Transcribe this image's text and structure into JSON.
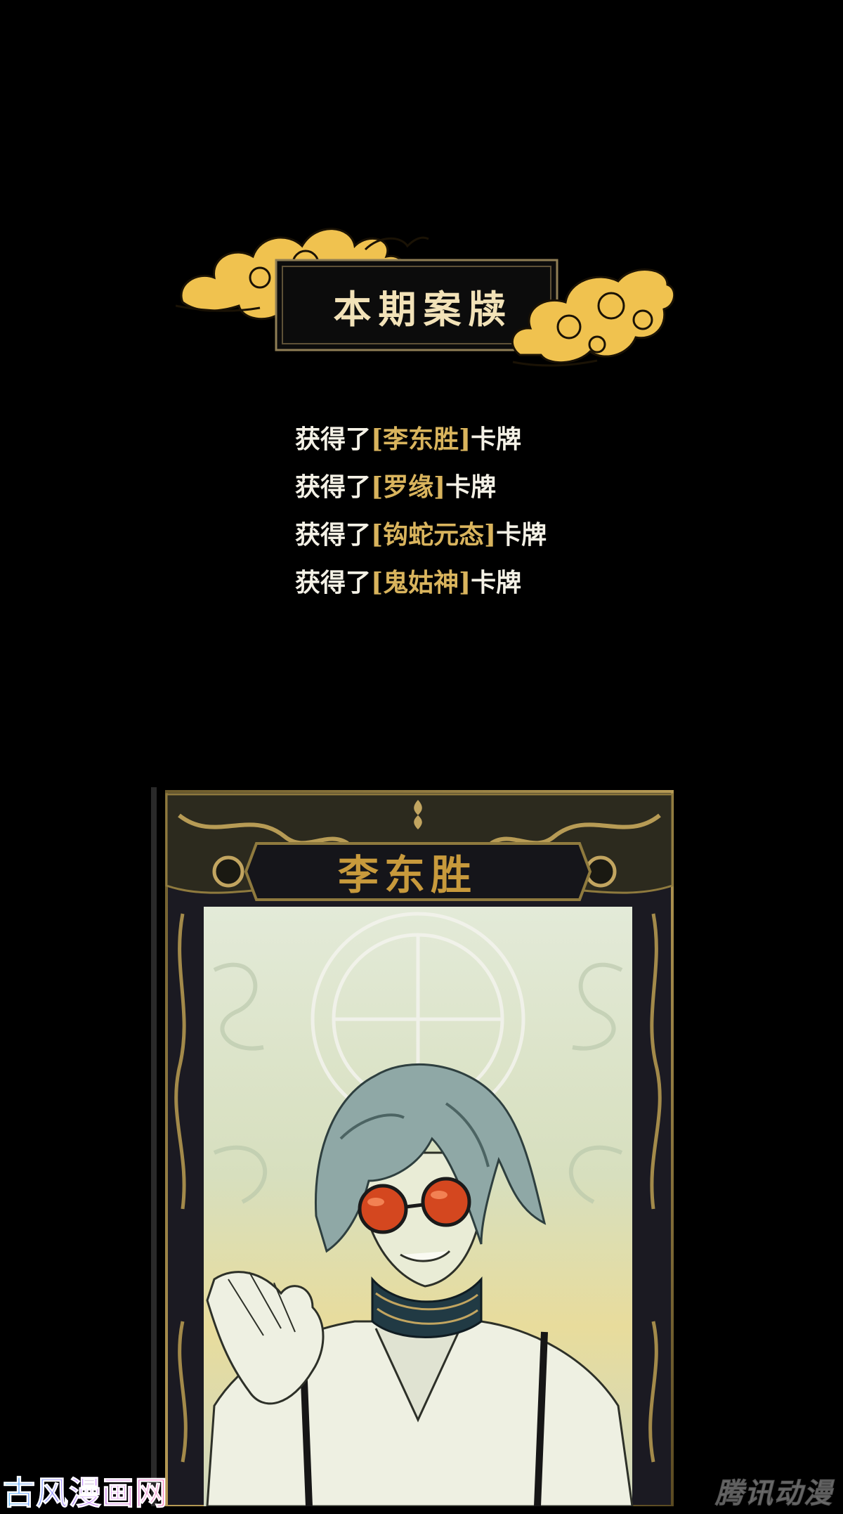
{
  "banner": {
    "title": "本期案牍"
  },
  "obtained": {
    "prefix": "获得了",
    "suffix": "卡牌",
    "open_bracket": "[",
    "close_bracket": "]",
    "cards": [
      {
        "name": "李东胜"
      },
      {
        "name": "罗缘"
      },
      {
        "name": "钩蛇元态"
      },
      {
        "name": "鬼姑神"
      }
    ]
  },
  "card": {
    "name": "李东胜"
  },
  "watermarks": {
    "left": "古风漫画网",
    "right": "腾讯动漫"
  },
  "colors": {
    "background": "#000000",
    "gold": "#d9b45d",
    "cloud": "#f0c24f",
    "card_bg": "#dfe6cf"
  }
}
